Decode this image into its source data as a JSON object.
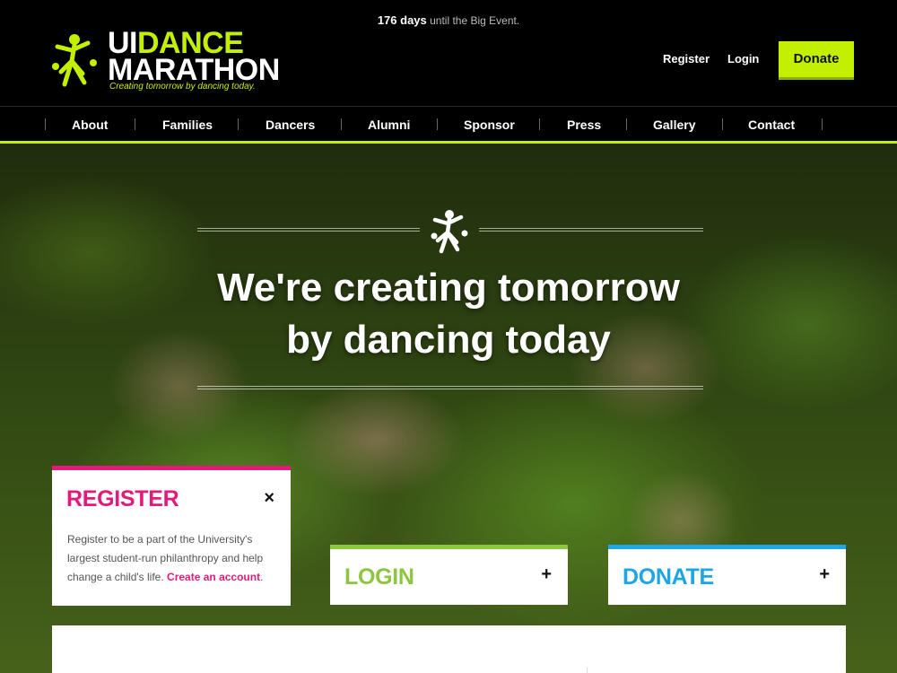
{
  "colors": {
    "accent": "#c3f000",
    "register": "#e6197a",
    "donate": "#1da6e6",
    "login": "#8cc63f"
  },
  "header": {
    "countdown_days": "176 days",
    "countdown_suffix": "until the Big Event.",
    "logo": {
      "word_ui": "UI",
      "word_dance": "DANCE",
      "word_marathon": "MARATHON",
      "tagline": "Creating tomorrow by dancing today."
    },
    "links": {
      "register": "Register",
      "login": "Login"
    },
    "donate_label": "Donate"
  },
  "nav": {
    "items": [
      {
        "label": "About"
      },
      {
        "label": "Families"
      },
      {
        "label": "Dancers"
      },
      {
        "label": "Alumni"
      },
      {
        "label": "Sponsor"
      },
      {
        "label": "Press"
      },
      {
        "label": "Gallery"
      },
      {
        "label": "Contact"
      }
    ]
  },
  "hero": {
    "title_line1": "We're creating tomorrow",
    "title_line2": "by dancing today"
  },
  "cards": {
    "register": {
      "title": "REGISTER",
      "close": "×",
      "body": "Register to be a part of the University's largest student-run philanthropy and help change a child's life.",
      "link": "Create an account",
      "end": "."
    },
    "login": {
      "title": "LOGIN",
      "expand": "+"
    },
    "donate": {
      "title": "DONATE",
      "expand": "+"
    }
  }
}
